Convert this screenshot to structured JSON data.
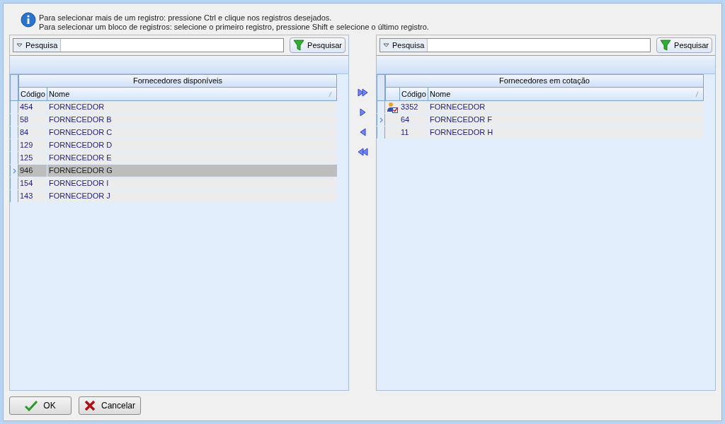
{
  "info": {
    "lines": [
      "Para selecionar mais de um registro: pressione Ctrl e clique nos registros desejados.",
      "Para selecionar um bloco de registros: selecione o primeiro registro, pressione Shift e selecione o último registro."
    ]
  },
  "panels": [
    {
      "search_label": "Pesquisa",
      "search_button": "Pesquisar",
      "grid_title": "Fornecedores disponíveis",
      "columns": [
        "Código",
        "Nome"
      ],
      "rows": [
        {
          "code": "454",
          "name": "FORNECEDOR",
          "selected": false,
          "current": false
        },
        {
          "code": "58",
          "name": "FORNECEDOR B",
          "selected": false,
          "current": false
        },
        {
          "code": "84",
          "name": "FORNECEDOR C",
          "selected": false,
          "current": false
        },
        {
          "code": "129",
          "name": "FORNECEDOR D",
          "selected": false,
          "current": false
        },
        {
          "code": "125",
          "name": "FORNECEDOR E",
          "selected": false,
          "current": false
        },
        {
          "code": "946",
          "name": "FORNECEDOR G",
          "selected": true,
          "current": true
        },
        {
          "code": "154",
          "name": "FORNECEDOR I",
          "selected": false,
          "current": false
        },
        {
          "code": "143",
          "name": "FORNECEDOR J",
          "selected": false,
          "current": false
        }
      ]
    },
    {
      "search_label": "Pesquisa",
      "search_button": "Pesquisar",
      "grid_title": "Fornecedores em cotação",
      "columns": [
        "Código",
        "Nome"
      ],
      "rows": [
        {
          "code": "3352",
          "name": "FORNECEDOR",
          "selected": false,
          "current": false,
          "flagged": true
        },
        {
          "code": "64",
          "name": "FORNECEDOR F",
          "selected": false,
          "current": true,
          "flagged": false
        },
        {
          "code": "11",
          "name": "FORNECEDOR H",
          "selected": false,
          "current": false,
          "flagged": false
        }
      ]
    }
  ],
  "buttons": [
    {
      "kind": "ok",
      "label": "OK"
    },
    {
      "kind": "cancel",
      "label": "Cancelar"
    }
  ]
}
